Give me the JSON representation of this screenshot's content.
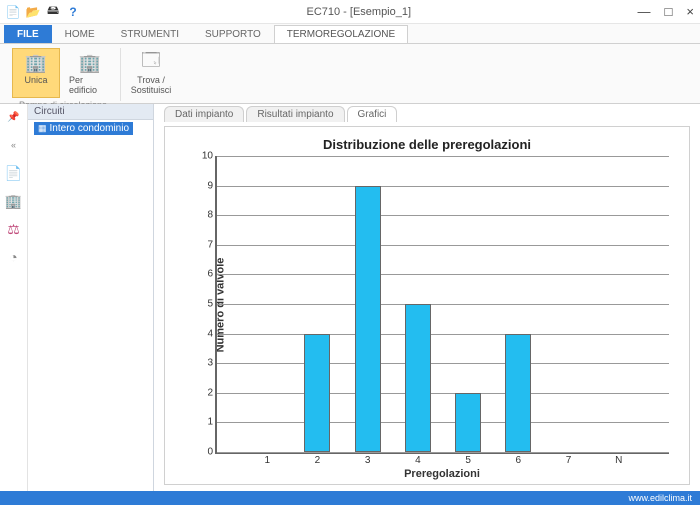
{
  "window": {
    "title": "EC710 - [Esempio_1]",
    "qat_icons": [
      "new-doc-icon",
      "open-folder-icon",
      "print-icon",
      "help-icon"
    ]
  },
  "ribbon": {
    "tabs": [
      "FILE",
      "HOME",
      "STRUMENTI",
      "SUPPORTO",
      "TERMOREGOLAZIONE"
    ],
    "active_tab": "TERMOREGOLAZIONE",
    "group_label": "Pompa di circolazione",
    "buttons": {
      "unica": "Unica",
      "per_edificio": "Per edificio",
      "trova": "Trova / Sostituisci"
    }
  },
  "sidebar": {
    "header": "Circuiti",
    "items": [
      "Intero condominio"
    ]
  },
  "content_tabs": [
    "Dati impianto",
    "Risultati impianto",
    "Grafici"
  ],
  "content_active": "Grafici",
  "statusbar": {
    "url": "www.edilclima.it"
  },
  "chart_data": {
    "type": "bar",
    "title": "Distribuzione delle preregolazioni",
    "xlabel": "Preregolazioni",
    "ylabel": "Numero di valvole",
    "categories": [
      "1",
      "2",
      "3",
      "4",
      "5",
      "6",
      "7",
      "N"
    ],
    "values": [
      0,
      4,
      9,
      5,
      2,
      4,
      0,
      0
    ],
    "ylim": [
      0,
      10
    ],
    "yticks": [
      0,
      1,
      2,
      3,
      4,
      5,
      6,
      7,
      8,
      9,
      10
    ]
  }
}
